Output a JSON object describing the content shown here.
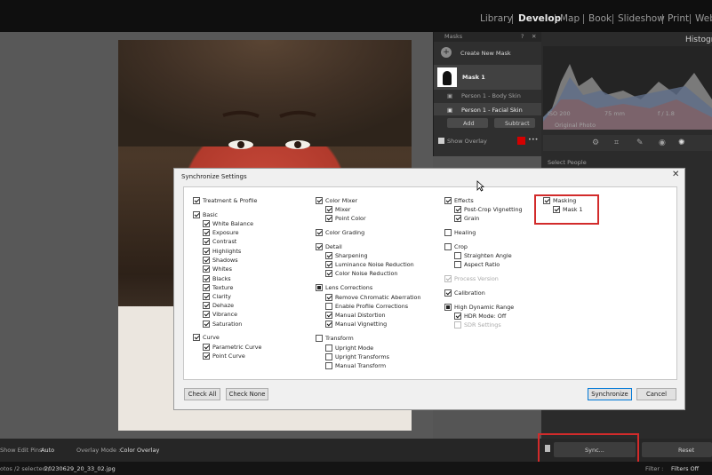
{
  "modules": {
    "library": "Library",
    "develop": "Develop",
    "map": "Map",
    "book": "Book",
    "slideshow": "Slideshow",
    "print": "Print",
    "web": "Web"
  },
  "right_panel": {
    "histogram_title": "Histogra",
    "iso": "ISO 200",
    "focal": "75 mm",
    "aperture": "f / 1.8",
    "original_photo": "Original Photo",
    "select_people": "Select People"
  },
  "masks_panel": {
    "title": "Masks",
    "create_new": "Create New Mask",
    "mask_name": "Mask 1",
    "sub1": "Person 1 - Body Skin",
    "sub2": "Person 1 - Facial Skin",
    "add": "Add",
    "subtract": "Subtract",
    "show_overlay": "Show Overlay",
    "overlay_color": "#d40000"
  },
  "dialog": {
    "title": "Synchronize Settings",
    "col1": [
      {
        "label": "Treatment & Profile",
        "state": "on"
      },
      {
        "label": "Basic",
        "state": "on"
      },
      {
        "label": "White Balance",
        "state": "on"
      },
      {
        "label": "Exposure",
        "state": "on"
      },
      {
        "label": "Contrast",
        "state": "on"
      },
      {
        "label": "Highlights",
        "state": "on"
      },
      {
        "label": "Shadows",
        "state": "on"
      },
      {
        "label": "Whites",
        "state": "on"
      },
      {
        "label": "Blacks",
        "state": "on"
      },
      {
        "label": "Texture",
        "state": "on"
      },
      {
        "label": "Clarity",
        "state": "on"
      },
      {
        "label": "Dehaze",
        "state": "on"
      },
      {
        "label": "Vibrance",
        "state": "on"
      },
      {
        "label": "Saturation",
        "state": "on"
      },
      {
        "label": "Curve",
        "state": "on"
      },
      {
        "label": "Parametric Curve",
        "state": "on"
      },
      {
        "label": "Point Curve",
        "state": "on"
      }
    ],
    "col2": [
      {
        "label": "Color Mixer",
        "state": "on"
      },
      {
        "label": "Mixer",
        "state": "on"
      },
      {
        "label": "Point Color",
        "state": "on"
      },
      {
        "label": "Color Grading",
        "state": "on"
      },
      {
        "label": "Detail",
        "state": "on"
      },
      {
        "label": "Sharpening",
        "state": "on"
      },
      {
        "label": "Luminance Noise Reduction",
        "state": "on"
      },
      {
        "label": "Color Noise Reduction",
        "state": "on"
      },
      {
        "label": "Lens Corrections",
        "state": "part"
      },
      {
        "label": "Remove Chromatic Aberration",
        "state": "on"
      },
      {
        "label": "Enable Profile Corrections",
        "state": "off"
      },
      {
        "label": "Manual Distortion",
        "state": "on"
      },
      {
        "label": "Manual Vignetting",
        "state": "on"
      },
      {
        "label": "Transform",
        "state": "off"
      },
      {
        "label": "Upright Mode",
        "state": "off"
      },
      {
        "label": "Upright Transforms",
        "state": "off"
      },
      {
        "label": "Manual Transform",
        "state": "off"
      }
    ],
    "col3": [
      {
        "label": "Effects",
        "state": "on"
      },
      {
        "label": "Post-Crop Vignetting",
        "state": "on"
      },
      {
        "label": "Grain",
        "state": "on"
      },
      {
        "label": "Healing",
        "state": "off"
      },
      {
        "label": "Crop",
        "state": "off"
      },
      {
        "label": "Straighten Angle",
        "state": "off"
      },
      {
        "label": "Aspect Ratio",
        "state": "off"
      },
      {
        "label": "Process Version",
        "state": "dis-on"
      },
      {
        "label": "Calibration",
        "state": "on"
      },
      {
        "label": "High Dynamic Range",
        "state": "part"
      },
      {
        "label": "HDR Mode: Off",
        "state": "on"
      },
      {
        "label": "SDR Settings",
        "state": "dis-off"
      }
    ],
    "col4": [
      {
        "label": "Masking",
        "state": "on"
      },
      {
        "label": "Mask 1",
        "state": "on"
      }
    ],
    "check_all": "Check All",
    "check_none": "Check None",
    "synchronize": "Synchronize",
    "cancel": "Cancel"
  },
  "bottom_bar": {
    "edit_pins_label": "Show Edit Pins :",
    "edit_pins_value": "Auto",
    "overlay_label": "Overlay Mode :",
    "overlay_value": "Color Overlay",
    "sync": "Sync...",
    "reset": "Reset"
  },
  "status_bar": {
    "photos": "otos /2 selected /",
    "filename": "20230629_20_33_02.jpg",
    "filter_label": "Filter :",
    "filter_value": "Filters Off"
  }
}
